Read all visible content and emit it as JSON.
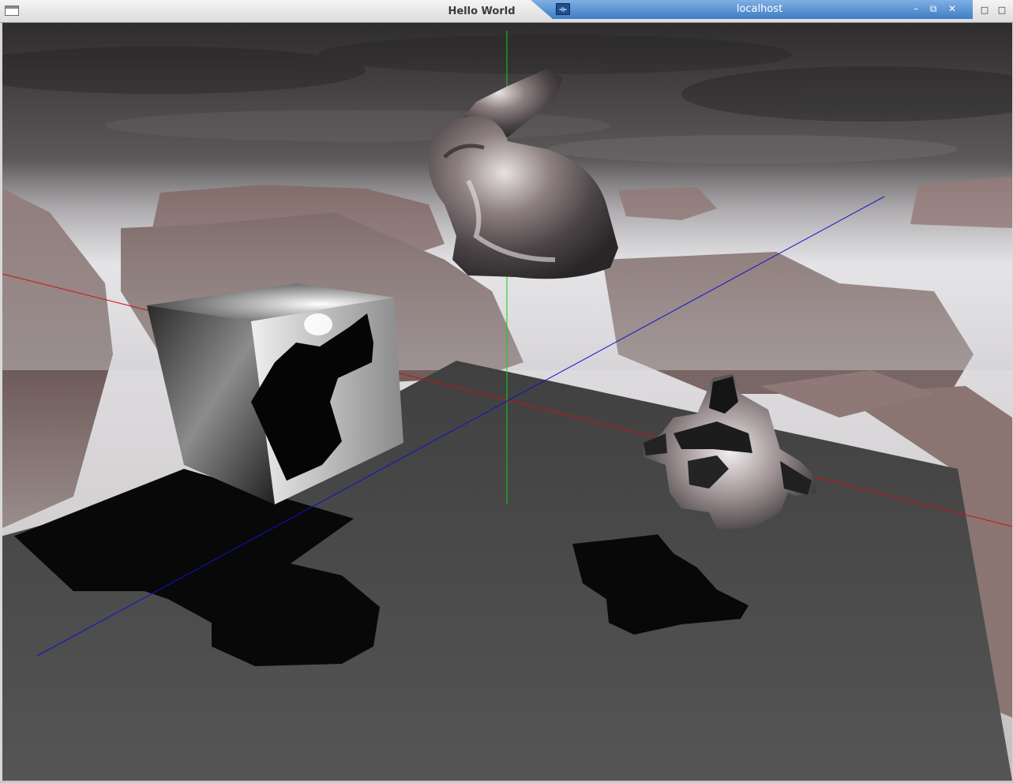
{
  "window": {
    "title": "Hello World",
    "panel_title": "localhost",
    "panel_minimize": "–",
    "panel_restore": "⧉",
    "panel_close": "✕",
    "right_button": "□",
    "app_icon": "⟛"
  },
  "scene": {
    "icons": [
      "window-icon",
      "pin-icon",
      "minimize-icon",
      "restore-icon",
      "close-icon",
      "maximize-icon"
    ],
    "colors": {
      "sky_dark": "#3a3638",
      "fog": "#d9d8dc",
      "rock": "#6d5a58",
      "floor": "#4a4a4a",
      "shadow": "#080808",
      "axis_x": "#d01010",
      "axis_y": "#10d010",
      "axis_z": "#1010d0"
    }
  }
}
